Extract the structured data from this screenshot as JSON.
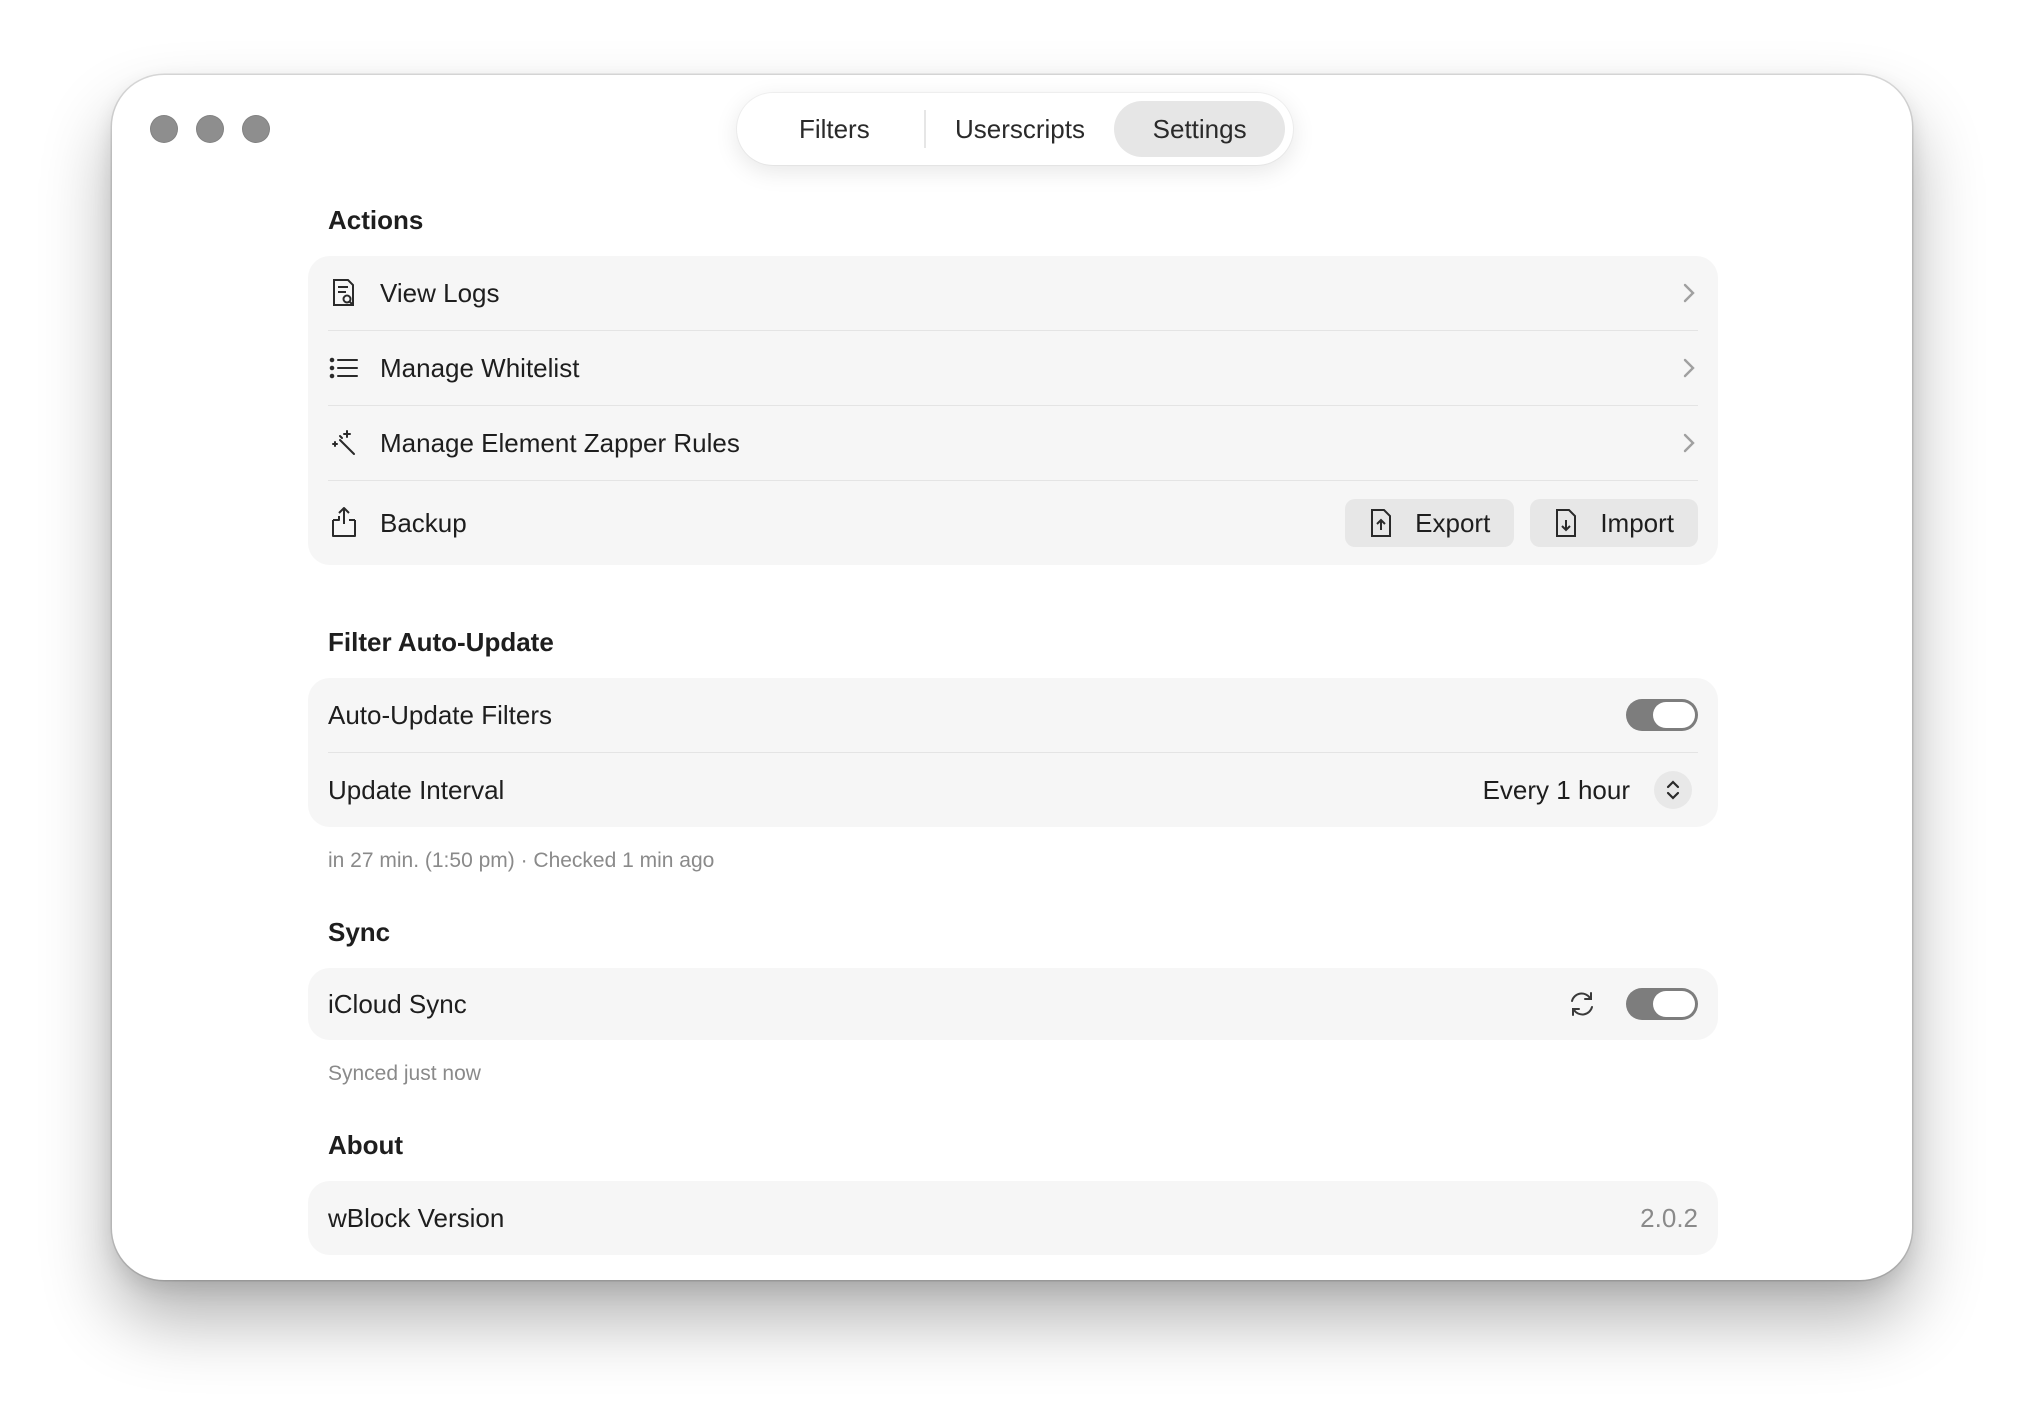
{
  "tabs": {
    "filters": "Filters",
    "userscripts": "Userscripts",
    "settings": "Settings"
  },
  "actions": {
    "title": "Actions",
    "view_logs": "View Logs",
    "manage_whitelist": "Manage Whitelist",
    "manage_zapper": "Manage Element Zapper Rules",
    "backup": "Backup",
    "export": "Export",
    "import": "Import"
  },
  "filter_update": {
    "title": "Filter Auto-Update",
    "auto_update_label": "Auto-Update Filters",
    "auto_update_on": true,
    "interval_label": "Update Interval",
    "interval_value": "Every 1 hour",
    "note": "in 27 min. (1:50 pm) · Checked 1 min ago"
  },
  "sync": {
    "title": "Sync",
    "icloud_label": "iCloud Sync",
    "icloud_on": true,
    "note": "Synced just now"
  },
  "about": {
    "title": "About",
    "version_label": "wBlock Version",
    "version_value": "2.0.2"
  },
  "icons": [
    "log-icon",
    "list-icon",
    "wand-icon",
    "backup-icon",
    "export-icon",
    "import-icon",
    "chevron-right-icon",
    "stepper-icon",
    "sync-icon"
  ],
  "colors": {
    "toggle_track": "#7d7d7d",
    "card_bg": "#f6f6f6",
    "selected_tab": "#e6e6e6"
  }
}
